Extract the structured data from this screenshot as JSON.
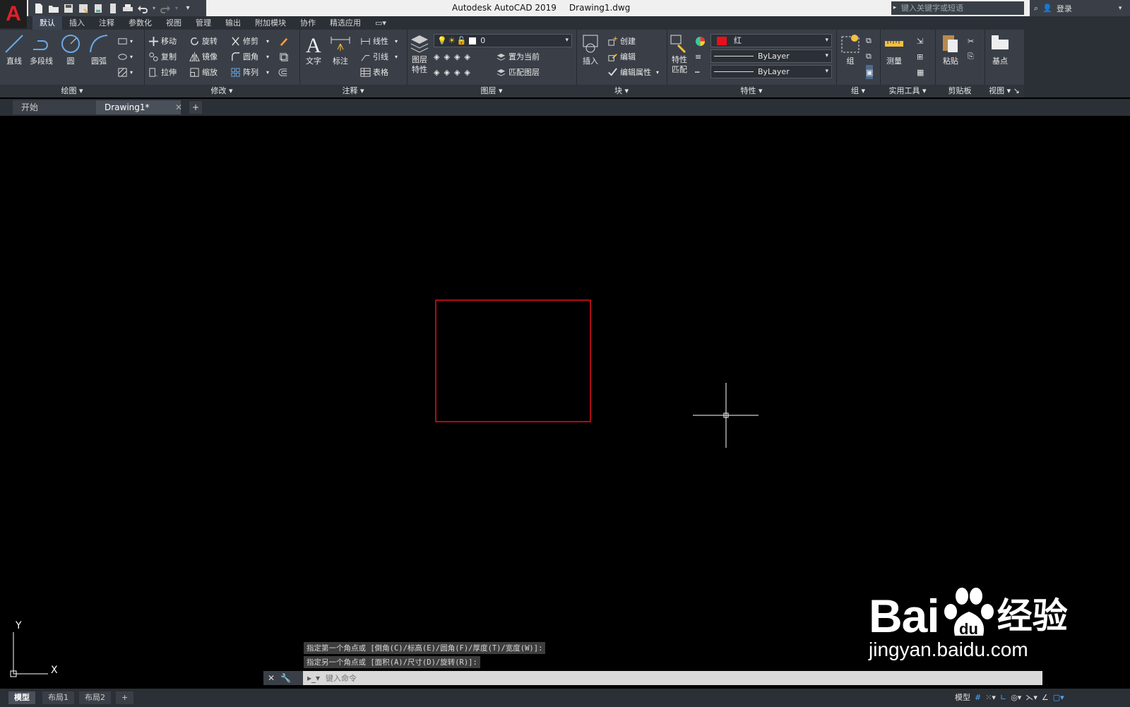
{
  "app": {
    "logo": "A",
    "title": "Autodesk AutoCAD 2019",
    "filename": "Drawing1.dwg"
  },
  "quick_access": [
    "new-icon",
    "open-icon",
    "save-icon",
    "saveas-icon",
    "publish-icon",
    "plot-icon",
    "print-icon",
    "undo-icon",
    "redo-icon",
    "customize-icon"
  ],
  "search": {
    "placeholder": "键入关键字或短语"
  },
  "user": {
    "login": "登录"
  },
  "menu_tabs": [
    "默认",
    "插入",
    "注释",
    "参数化",
    "视图",
    "管理",
    "输出",
    "附加模块",
    "协作",
    "精选应用"
  ],
  "ribbon": {
    "draw": {
      "title": "绘图",
      "line": "直线",
      "polyline": "多段线",
      "circle": "圆",
      "arc": "圆弧"
    },
    "modify": {
      "title": "修改",
      "move": "移动",
      "rotate": "旋转",
      "trim": "修剪",
      "copy": "复制",
      "mirror": "镜像",
      "fillet": "圆角",
      "stretch": "拉伸",
      "scale": "缩放",
      "array": "阵列"
    },
    "annotation": {
      "title": "注释",
      "text": "文字",
      "dimension": "标注",
      "linear": "线性",
      "leader": "引线",
      "table": "表格"
    },
    "layers": {
      "title": "图层",
      "layer_properties": "图层特性",
      "current_layer": "0",
      "set_current": "置为当前",
      "match_layer": "匹配图层"
    },
    "block": {
      "title": "块",
      "insert": "插入",
      "create": "创建",
      "edit": "编辑",
      "edit_attributes": "编辑属性"
    },
    "properties": {
      "title": "特性",
      "match": "特性匹配",
      "color": "红",
      "color_hex": "#e8101a",
      "linetype": "ByLayer",
      "lineweight": "ByLayer"
    },
    "groups": {
      "title": "组",
      "group": "组"
    },
    "utilities": {
      "title": "实用工具",
      "measure": "测量"
    },
    "clipboard": {
      "title": "剪贴板",
      "paste": "粘贴"
    },
    "view": {
      "title": "视图",
      "base": "基点"
    }
  },
  "file_tabs": {
    "start": "开始",
    "drawing": "Drawing1*"
  },
  "command_history": [
    "指定第一个角点或 [倒角(C)/标高(E)/圆角(F)/厚度(T)/宽度(W)]:",
    "指定另一个角点或 [面积(A)/尺寸(D)/旋转(R)]:"
  ],
  "command_input": {
    "placeholder": "键入命令"
  },
  "layout_tabs": [
    "模型",
    "布局1",
    "布局2"
  ],
  "status": {
    "model": "模型"
  },
  "ucs": {
    "x": "X",
    "y": "Y"
  },
  "watermark": {
    "brand": "Bai",
    "brand2": "经验",
    "url": "jingyan.baidu.com"
  },
  "colors": {
    "ribbon_bg": "#3a3f47",
    "canvas_bg": "#000000",
    "rectangle": "#e8101a",
    "crosshair": "#ffffff"
  }
}
